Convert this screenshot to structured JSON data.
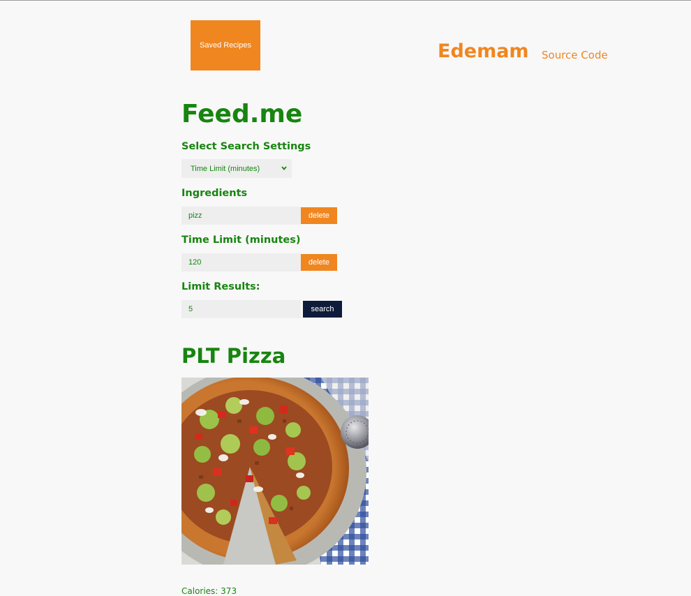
{
  "header": {
    "saved_recipes_label": "Saved Recipes",
    "brand": "Edemam",
    "source_code_label": "Source Code"
  },
  "app": {
    "title": "Feed.me"
  },
  "settings": {
    "label": "Select Search Settings",
    "selected_option": "Time Limit (minutes)"
  },
  "ingredients": {
    "label": "Ingredients",
    "value": "pizz",
    "delete_label": "delete"
  },
  "time_limit": {
    "label": "Time Limit (minutes)",
    "value": "120",
    "delete_label": "delete"
  },
  "limit_results": {
    "label": "Limit Results:",
    "value": "5",
    "search_label": "search"
  },
  "recipe": {
    "title": "PLT Pizza",
    "calories_text": "Calories: 373"
  },
  "colors": {
    "accent_orange": "#f0861f",
    "title_green": "#17850f",
    "search_button_navy": "#0f1b3a",
    "page_background": "#f8f8f8"
  },
  "icons": {
    "select_arrow": "chevron-down-icon"
  }
}
